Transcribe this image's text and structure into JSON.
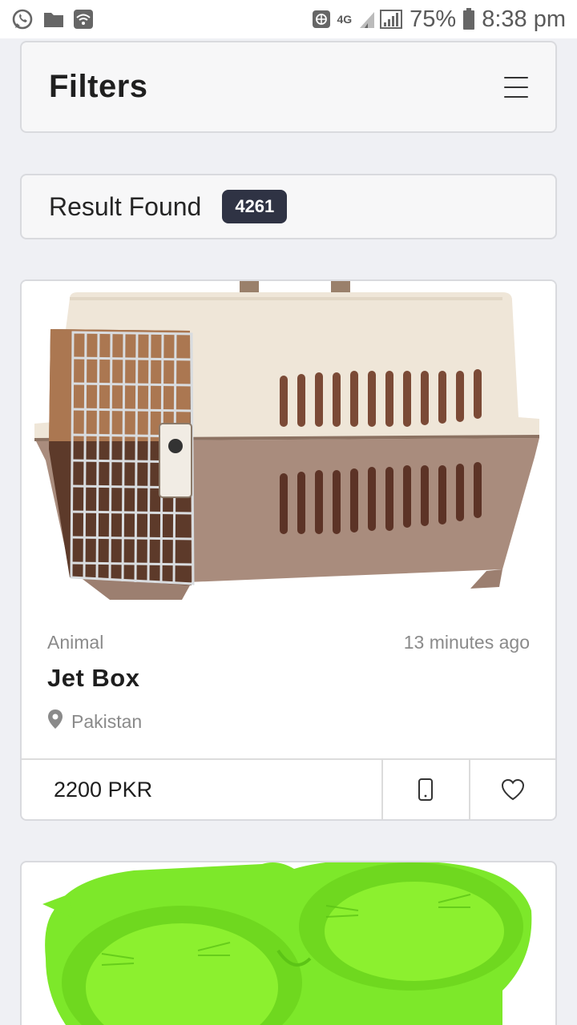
{
  "status_bar": {
    "network_type": "4G",
    "battery_percent": "75%",
    "time": "8:38 pm",
    "icons": [
      "whatsapp-icon",
      "folder-icon",
      "wifi-icon",
      "vpn-icon",
      "network-icon",
      "signal-icon",
      "battery-icon"
    ]
  },
  "filters": {
    "title": "Filters",
    "menu_icon": "hamburger-menu-icon"
  },
  "results": {
    "label": "Result Found",
    "count": "4261"
  },
  "listings": [
    {
      "image": "pet-carrier-crate",
      "category": "Animal",
      "posted": "13 minutes ago",
      "title": "Jet Box",
      "location": "Pakistan",
      "price": "2200 PKR",
      "actions": [
        "phone-icon",
        "heart-icon"
      ]
    },
    {
      "image": "green-double-pet-bowl"
    }
  ],
  "colors": {
    "background": "#eff0f4",
    "card": "#f7f7f8",
    "badge": "#2f3344",
    "muted_text": "#8a8a8a"
  }
}
